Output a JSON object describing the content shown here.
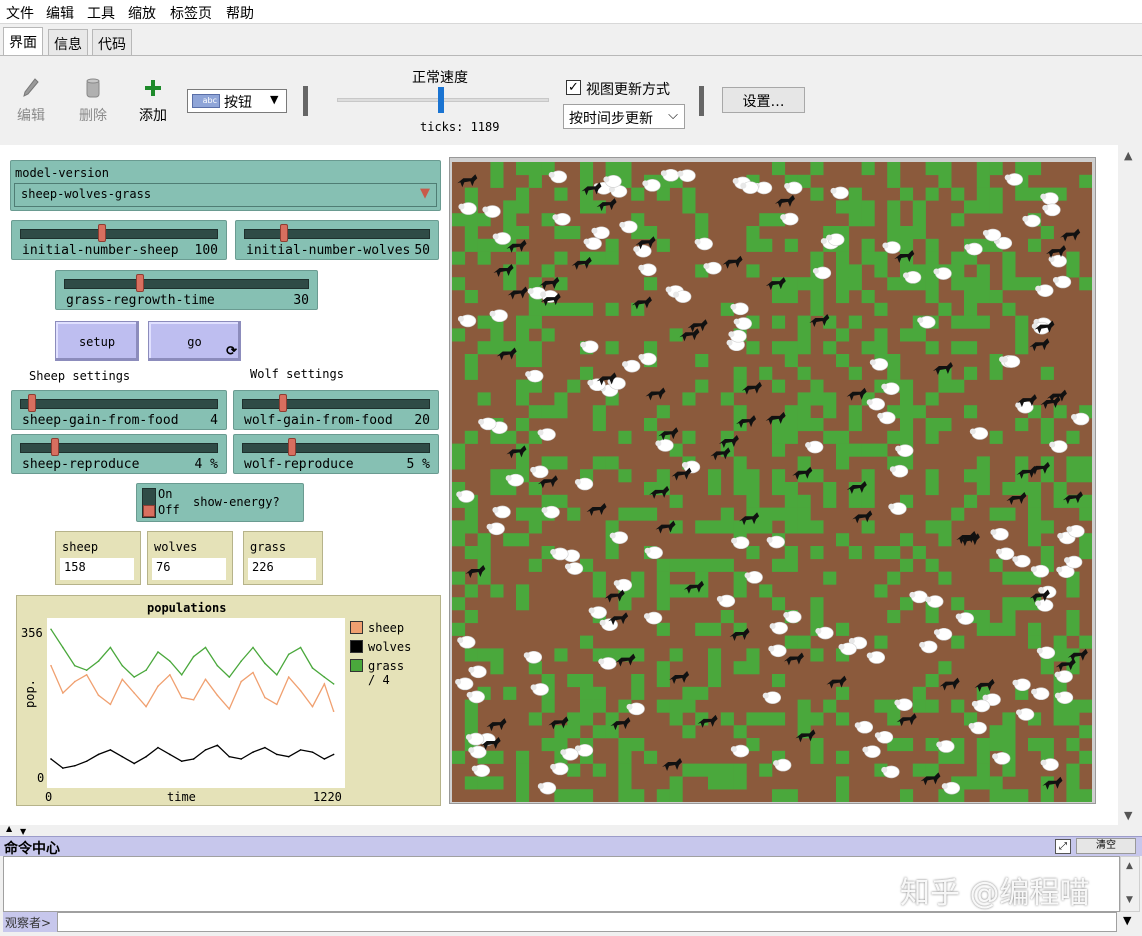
{
  "menubar": {
    "items": [
      "文件",
      "编辑",
      "工具",
      "缩放",
      "标签页",
      "帮助"
    ]
  },
  "tabs": [
    "界面",
    "信息",
    "代码"
  ],
  "toolbar": {
    "edit_label": "编辑",
    "delete_label": "删除",
    "add_label": "添加",
    "widget_type_icon_text": "abc",
    "widget_type_value": "按钮",
    "speed_label": "正常速度",
    "speed_level": 0.5,
    "ticks_text": "ticks: 1189",
    "view_updates_label": "视图更新方式",
    "view_updates_checked": true,
    "update_mode_value": "按时间步更新",
    "settings_label": "设置…"
  },
  "interface": {
    "model_version": {
      "label": "model-version",
      "value": "sheep-wolves-grass"
    },
    "sliders": {
      "initial_number_sheep": {
        "label": "initial-number-sheep",
        "value": "100",
        "level": 0.4
      },
      "initial_number_wolves": {
        "label": "initial-number-wolves",
        "value": "50",
        "level": 0.2
      },
      "grass_regrowth_time": {
        "label": "grass-regrowth-time",
        "value": "30",
        "level": 0.3
      },
      "sheep_gain_from_food": {
        "label": "sheep-gain-from-food",
        "value": "4",
        "level": 0.04
      },
      "wolf_gain_from_food": {
        "label": "wolf-gain-from-food",
        "value": "20",
        "level": 0.2
      },
      "sheep_reproduce": {
        "label": "sheep-reproduce",
        "value": "4 %",
        "level": 0.16
      },
      "wolf_reproduce": {
        "label": "wolf-reproduce",
        "value": "5 %",
        "level": 0.25
      }
    },
    "buttons": {
      "setup": "setup",
      "go": "go"
    },
    "notes": {
      "sheep_settings": "Sheep settings",
      "wolf_settings": "Wolf settings"
    },
    "switch": {
      "on": "On",
      "off": "Off",
      "label": "show-energy?",
      "state": "off"
    },
    "monitors": {
      "sheep": {
        "label": "sheep",
        "value": "158"
      },
      "wolves": {
        "label": "wolves",
        "value": "76"
      },
      "grass": {
        "label": "grass",
        "value": "226"
      }
    }
  },
  "plot": {
    "title": "populations",
    "ylabel": "pop.",
    "xlabel": "time",
    "ymax_label": "356",
    "ymin_label": "0",
    "xmin_label": "0",
    "xmax_label": "1220",
    "legend": [
      {
        "name": "sheep",
        "color": "#f0a070"
      },
      {
        "name": "wolves",
        "color": "#000000"
      },
      {
        "name": "grass / 4",
        "color": "#4aa83c"
      }
    ]
  },
  "chart_data": {
    "type": "line",
    "title": "populations",
    "xlabel": "time",
    "ylabel": "pop.",
    "xlim": [
      0,
      1220
    ],
    "ylim": [
      0,
      356
    ],
    "x": [
      0,
      50,
      100,
      150,
      200,
      250,
      300,
      350,
      400,
      450,
      500,
      550,
      600,
      650,
      700,
      750,
      800,
      850,
      900,
      950,
      1000,
      1050,
      1100,
      1150,
      1189
    ],
    "series": [
      {
        "name": "sheep",
        "color": "#f0a070",
        "values": [
          260,
          200,
          225,
          240,
          195,
          175,
          230,
          200,
          170,
          215,
          240,
          190,
          185,
          230,
          195,
          165,
          225,
          245,
          190,
          175,
          235,
          205,
          170,
          220,
          160
        ]
      },
      {
        "name": "wolves",
        "color": "#000000",
        "values": [
          55,
          35,
          40,
          50,
          65,
          75,
          60,
          45,
          60,
          80,
          65,
          50,
          55,
          75,
          85,
          60,
          55,
          70,
          80,
          65,
          60,
          75,
          70,
          55,
          65
        ]
      },
      {
        "name": "grass / 4",
        "color": "#4aa83c",
        "values": [
          340,
          300,
          260,
          250,
          270,
          300,
          260,
          235,
          250,
          290,
          270,
          240,
          280,
          300,
          260,
          235,
          270,
          300,
          265,
          240,
          285,
          300,
          255,
          235,
          220
        ]
      }
    ]
  },
  "colors": {
    "grass": "#4aa83c",
    "dirt": "#8b5a3c",
    "sheep": "#ffffff",
    "wolf": "#000000",
    "widget_green": "#86c0b3",
    "button_purple": "#bebef0",
    "monitor_yellow": "#e5e2b8"
  },
  "command_center": {
    "title": "命令中心",
    "clear_label": "清空",
    "observer_label": "观察者>"
  },
  "watermark": "知乎 @编程喵"
}
